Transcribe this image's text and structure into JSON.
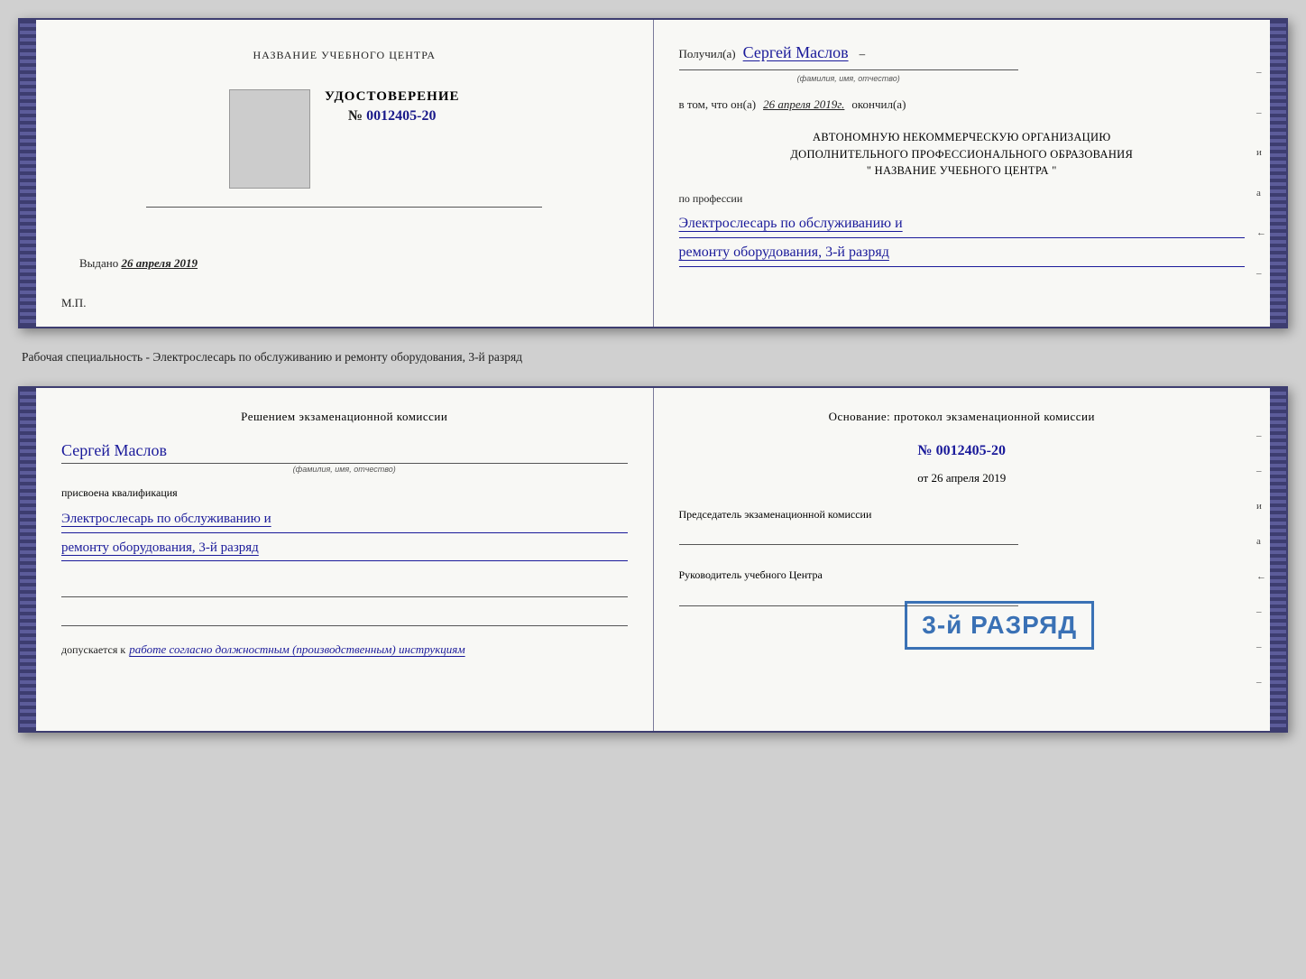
{
  "page": {
    "background": "#d0d0d0"
  },
  "top_certificate": {
    "left_page": {
      "school_name_label": "НАЗВАНИЕ УЧЕБНОГО ЦЕНТРА",
      "cert_title": "УДОСТОВЕРЕНИЕ",
      "cert_number_prefix": "№",
      "cert_number": "0012405-20",
      "issued_label": "Выдано",
      "issued_date": "26 апреля 2019",
      "mp_label": "М.П."
    },
    "right_page": {
      "recipient_label": "Получил(а)",
      "recipient_name": "Сергей Маслов",
      "fio_label": "(фамилия, имя, отчество)",
      "confirm_label": "в том, что он(а)",
      "confirm_date": "26 апреля 2019г.",
      "confirm_end": "окончил(а)",
      "org_line1": "АВТОНОМНУЮ НЕКОММЕРЧЕСКУЮ ОРГАНИЗАЦИЮ",
      "org_line2": "ДОПОЛНИТЕЛЬНОГО ПРОФЕССИОНАЛЬНОГО ОБРАЗОВАНИЯ",
      "org_line3": "\" НАЗВАНИЕ УЧЕБНОГО ЦЕНТРА \"",
      "profession_label": "по профессии",
      "profession_text": "Электрослесарь по обслуживанию и",
      "profession_text2": "ремонту оборудования, 3-й разряд"
    }
  },
  "middle_text": "Рабочая специальность - Электрослесарь по обслуживанию и ремонту оборудования, 3-й разряд",
  "bottom_certificate": {
    "left_page": {
      "decision_title": "Решением экзаменационной  комиссии",
      "person_name": "Сергей Маслов",
      "fio_label": "(фамилия, имя, отчество)",
      "qualification_label": "присвоена квалификация",
      "qualification_text": "Электрослесарь по обслуживанию и",
      "qualification_text2": "ремонту оборудования, 3-й разряд",
      "allowed_label": "допускается к",
      "allowed_text": "работе согласно должностным (производственным) инструкциям"
    },
    "right_page": {
      "basis_title": "Основание: протокол экзаменационной  комиссии",
      "number_prefix": "№",
      "basis_number": "0012405-20",
      "date_prefix": "от",
      "basis_date": "26 апреля 2019",
      "chairman_label": "Председатель экзаменационной комиссии",
      "director_label": "Руководитель учебного Центра"
    },
    "stamp": {
      "text": "3-й РАЗРЯД"
    }
  },
  "right_edge_chars": [
    "и",
    "а",
    "←",
    "–",
    "–",
    "–",
    "–"
  ]
}
